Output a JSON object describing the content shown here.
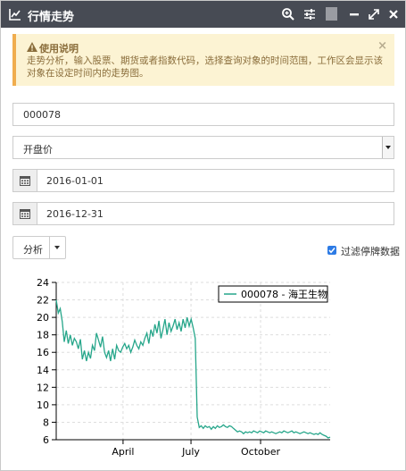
{
  "window": {
    "title": "行情走势",
    "icons": [
      "line-chart-icon",
      "zoom-icon",
      "sliders-icon",
      "minimize-icon",
      "maximize-icon",
      "close-icon"
    ]
  },
  "alert": {
    "title": "使用说明",
    "body": "走势分析，输入股票、期货或者指数代码，选择查询对象的时间范围，工作区会显示该对象在设定时间内的走势图。",
    "close": "×",
    "color": "#fcf3d3"
  },
  "form": {
    "code_value": "000078",
    "price_type": "开盘价",
    "start_date": "2016-01-01",
    "end_date": "2016-12-31",
    "analyze_label": "分析",
    "filter_label": "过滤停牌数据",
    "filter_checked": true
  },
  "chart_data": {
    "type": "line",
    "title": "",
    "xlabel": "",
    "ylabel": "",
    "x_ticks": [
      "April",
      "July",
      "October"
    ],
    "y_ticks": [
      6,
      8,
      10,
      12,
      14,
      16,
      18,
      20,
      22,
      24
    ],
    "ylim": [
      6,
      24
    ],
    "grid": true,
    "legend_position": "top-right",
    "series": [
      {
        "name": "000078 - 海王生物",
        "color": "#26a68a",
        "values": [
          22.0,
          20.5,
          21.0,
          19.5,
          17.2,
          18.5,
          17.0,
          18.0,
          16.8,
          17.6,
          17.2,
          16.4,
          17.5,
          15.2,
          16.2,
          15.0,
          16.0,
          15.3,
          16.8,
          16.2,
          18.2,
          17.4,
          16.6,
          17.8,
          16.0,
          15.4,
          16.2,
          15.0,
          16.4,
          15.2,
          16.8,
          16.2,
          16.0,
          16.6,
          17.0,
          16.4,
          16.8,
          16.0,
          16.6,
          17.4,
          16.8,
          16.4,
          17.2,
          16.8,
          17.6,
          18.2,
          17.0,
          18.6,
          17.8,
          19.2,
          18.2,
          19.6,
          17.6,
          18.6,
          19.8,
          18.0,
          19.4,
          18.4,
          19.0,
          19.8,
          18.6,
          19.4,
          18.4,
          19.8,
          18.8,
          20.0,
          19.0,
          19.8,
          18.8,
          17.6,
          8.6,
          7.4,
          7.6,
          7.3,
          7.6,
          7.4,
          7.5,
          7.2,
          7.5,
          7.3,
          7.6,
          7.4,
          7.5,
          7.7,
          7.5,
          7.4,
          7.6,
          7.5,
          7.3,
          7.1,
          6.9,
          7.0,
          6.9,
          6.7,
          6.9,
          6.8,
          6.9,
          6.8,
          7.0,
          6.9,
          6.8,
          7.0,
          6.9,
          6.8,
          7.0,
          6.9,
          6.8,
          6.9,
          6.8,
          6.7,
          6.8,
          6.9,
          6.8,
          7.0,
          6.9,
          6.8,
          6.9,
          7.0,
          6.8,
          6.9,
          6.8,
          6.7,
          6.8,
          6.9,
          6.8,
          6.7,
          6.8,
          6.7,
          6.6,
          6.7,
          6.6,
          6.8,
          6.6,
          6.5,
          6.4,
          6.2,
          6.3
        ]
      }
    ]
  }
}
